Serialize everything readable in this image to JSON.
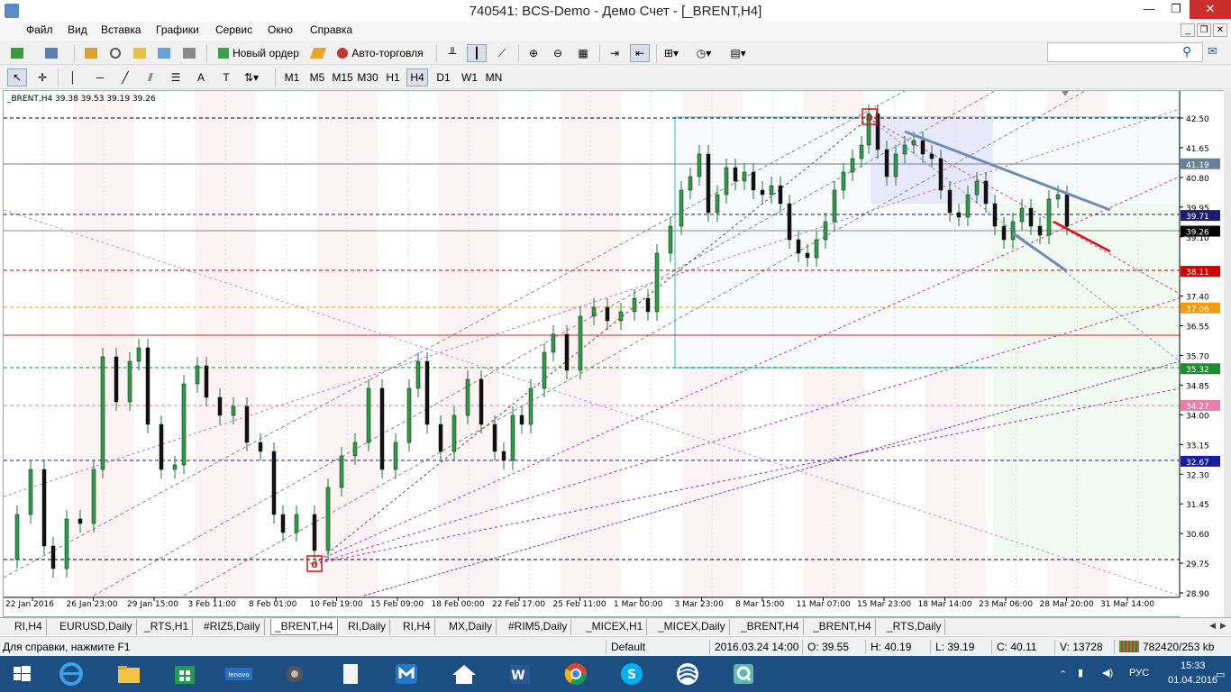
{
  "window": {
    "title": "740541: BCS-Demo - Демо Счет - [_BRENT,H4]",
    "min": "—",
    "max": "❐",
    "close": "✕"
  },
  "menu": [
    "Файл",
    "Вид",
    "Вставка",
    "Графики",
    "Сервис",
    "Окно",
    "Справка"
  ],
  "toolbar1": {
    "new_order": "Новый ордер",
    "auto_trading": "Авто-торговля"
  },
  "timeframes": [
    "M1",
    "M5",
    "M15",
    "M30",
    "H1",
    "H4",
    "D1",
    "W1",
    "MN"
  ],
  "active_timeframe": "H4",
  "chart": {
    "header": "_BRENT,H4  39.38 39.53 39.19 39.26",
    "y_labels": [
      "42.50",
      "41.65",
      "40.80",
      "39.95",
      "39.10",
      "37.40",
      "36.55",
      "35.70",
      "34.85",
      "34.00",
      "33.15",
      "32.30",
      "31.45",
      "30.60",
      "29.75",
      "28.90"
    ],
    "x_labels": [
      "22 Jan 2016",
      "26 Jan 23:00",
      "29 Jan 15:00",
      "3 Feb 11:00",
      "8 Feb 01:00",
      "10 Feb 19:00",
      "15 Feb 09:00",
      "18 Feb 00:00",
      "22 Feb 17:00",
      "25 Feb 11:00",
      "1 Mar 00:00",
      "3 Mar 23:00",
      "8 Mar 15:00",
      "11 Mar 07:00",
      "15 Mar 23:00",
      "18 Mar 14:00",
      "23 Mar 06:00",
      "28 Mar 20:00",
      "31 Mar 14:00"
    ],
    "price_tags": [
      {
        "value": "41.19",
        "bg": "#6c7f99"
      },
      {
        "value": "39.71",
        "bg": "#1c1c70"
      },
      {
        "value": "39.26",
        "bg": "#000000"
      },
      {
        "value": "38.11",
        "bg": "#cc0000"
      },
      {
        "value": "37.06",
        "bg": "#f39c12"
      },
      {
        "value": "35.32",
        "bg": "#1e8c2e"
      },
      {
        "value": "34.27",
        "bg": "#e87fa9"
      },
      {
        "value": "32.67",
        "bg": "#1c1ca0"
      }
    ],
    "marker_low": "0",
    "marker_high": "0"
  },
  "tabs": [
    "RI,H4",
    "EURUSD,Daily",
    "_RTS,H1",
    "#RIZ5,Daily",
    "_BRENT,H4",
    "RI,Daily",
    "RI,H4",
    "MX,Daily",
    "#RIM5,Daily",
    "_MICEX,H1",
    "_MICEX,Daily",
    "_BRENT,H4",
    "_BRENT,H4",
    "_RTS,Daily"
  ],
  "active_tab": 4,
  "status": {
    "help": "Для справки, нажмите F1",
    "profile": "Default",
    "datetime": "2016.03.24 14:00",
    "open": "O: 39.55",
    "high": "H: 40.19",
    "low": "L: 39.19",
    "close": "C: 40.11",
    "volume": "V: 13728",
    "traffic": "782420/253 kb"
  },
  "taskbar": {
    "lang": "РУС",
    "time": "15:33",
    "date": "01.04.2016"
  }
}
